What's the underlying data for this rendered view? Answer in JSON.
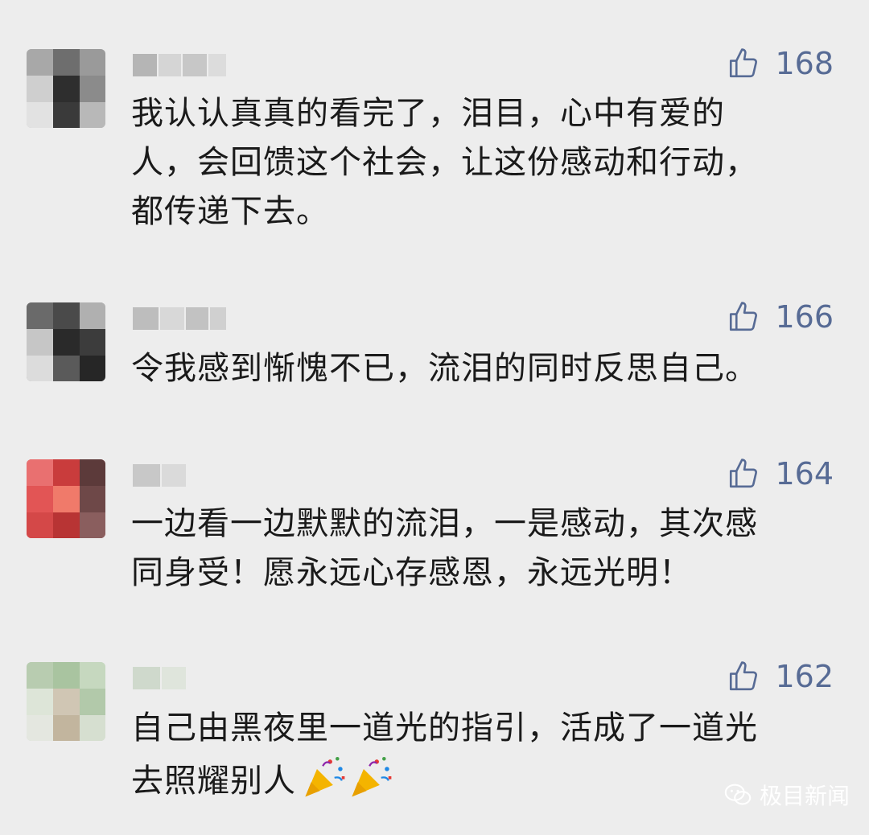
{
  "comments": [
    {
      "likes": "168",
      "text": "我认认真真的看完了，泪目，心中有爱的\n人，会回馈这个社会，让这份感动和行动，\n都传递下去。"
    },
    {
      "likes": "166",
      "text": "令我感到惭愧不已，流泪的同时反思自己。"
    },
    {
      "likes": "164",
      "text": "一边看一边默默的流泪，一是感动，其次感\n同身受！愿永远心存感恩，永远光明！"
    },
    {
      "likes": "162",
      "text": "自己由黑夜里一道光的指引，活成了一道光\n去照耀别人",
      "emoji": "party-popper-icon"
    }
  ],
  "watermark": {
    "text": "极目新闻",
    "icon": "wechat-icon"
  },
  "colors": {
    "background": "#ededed",
    "like_accent": "#576b95",
    "text": "#1a1a1a"
  }
}
